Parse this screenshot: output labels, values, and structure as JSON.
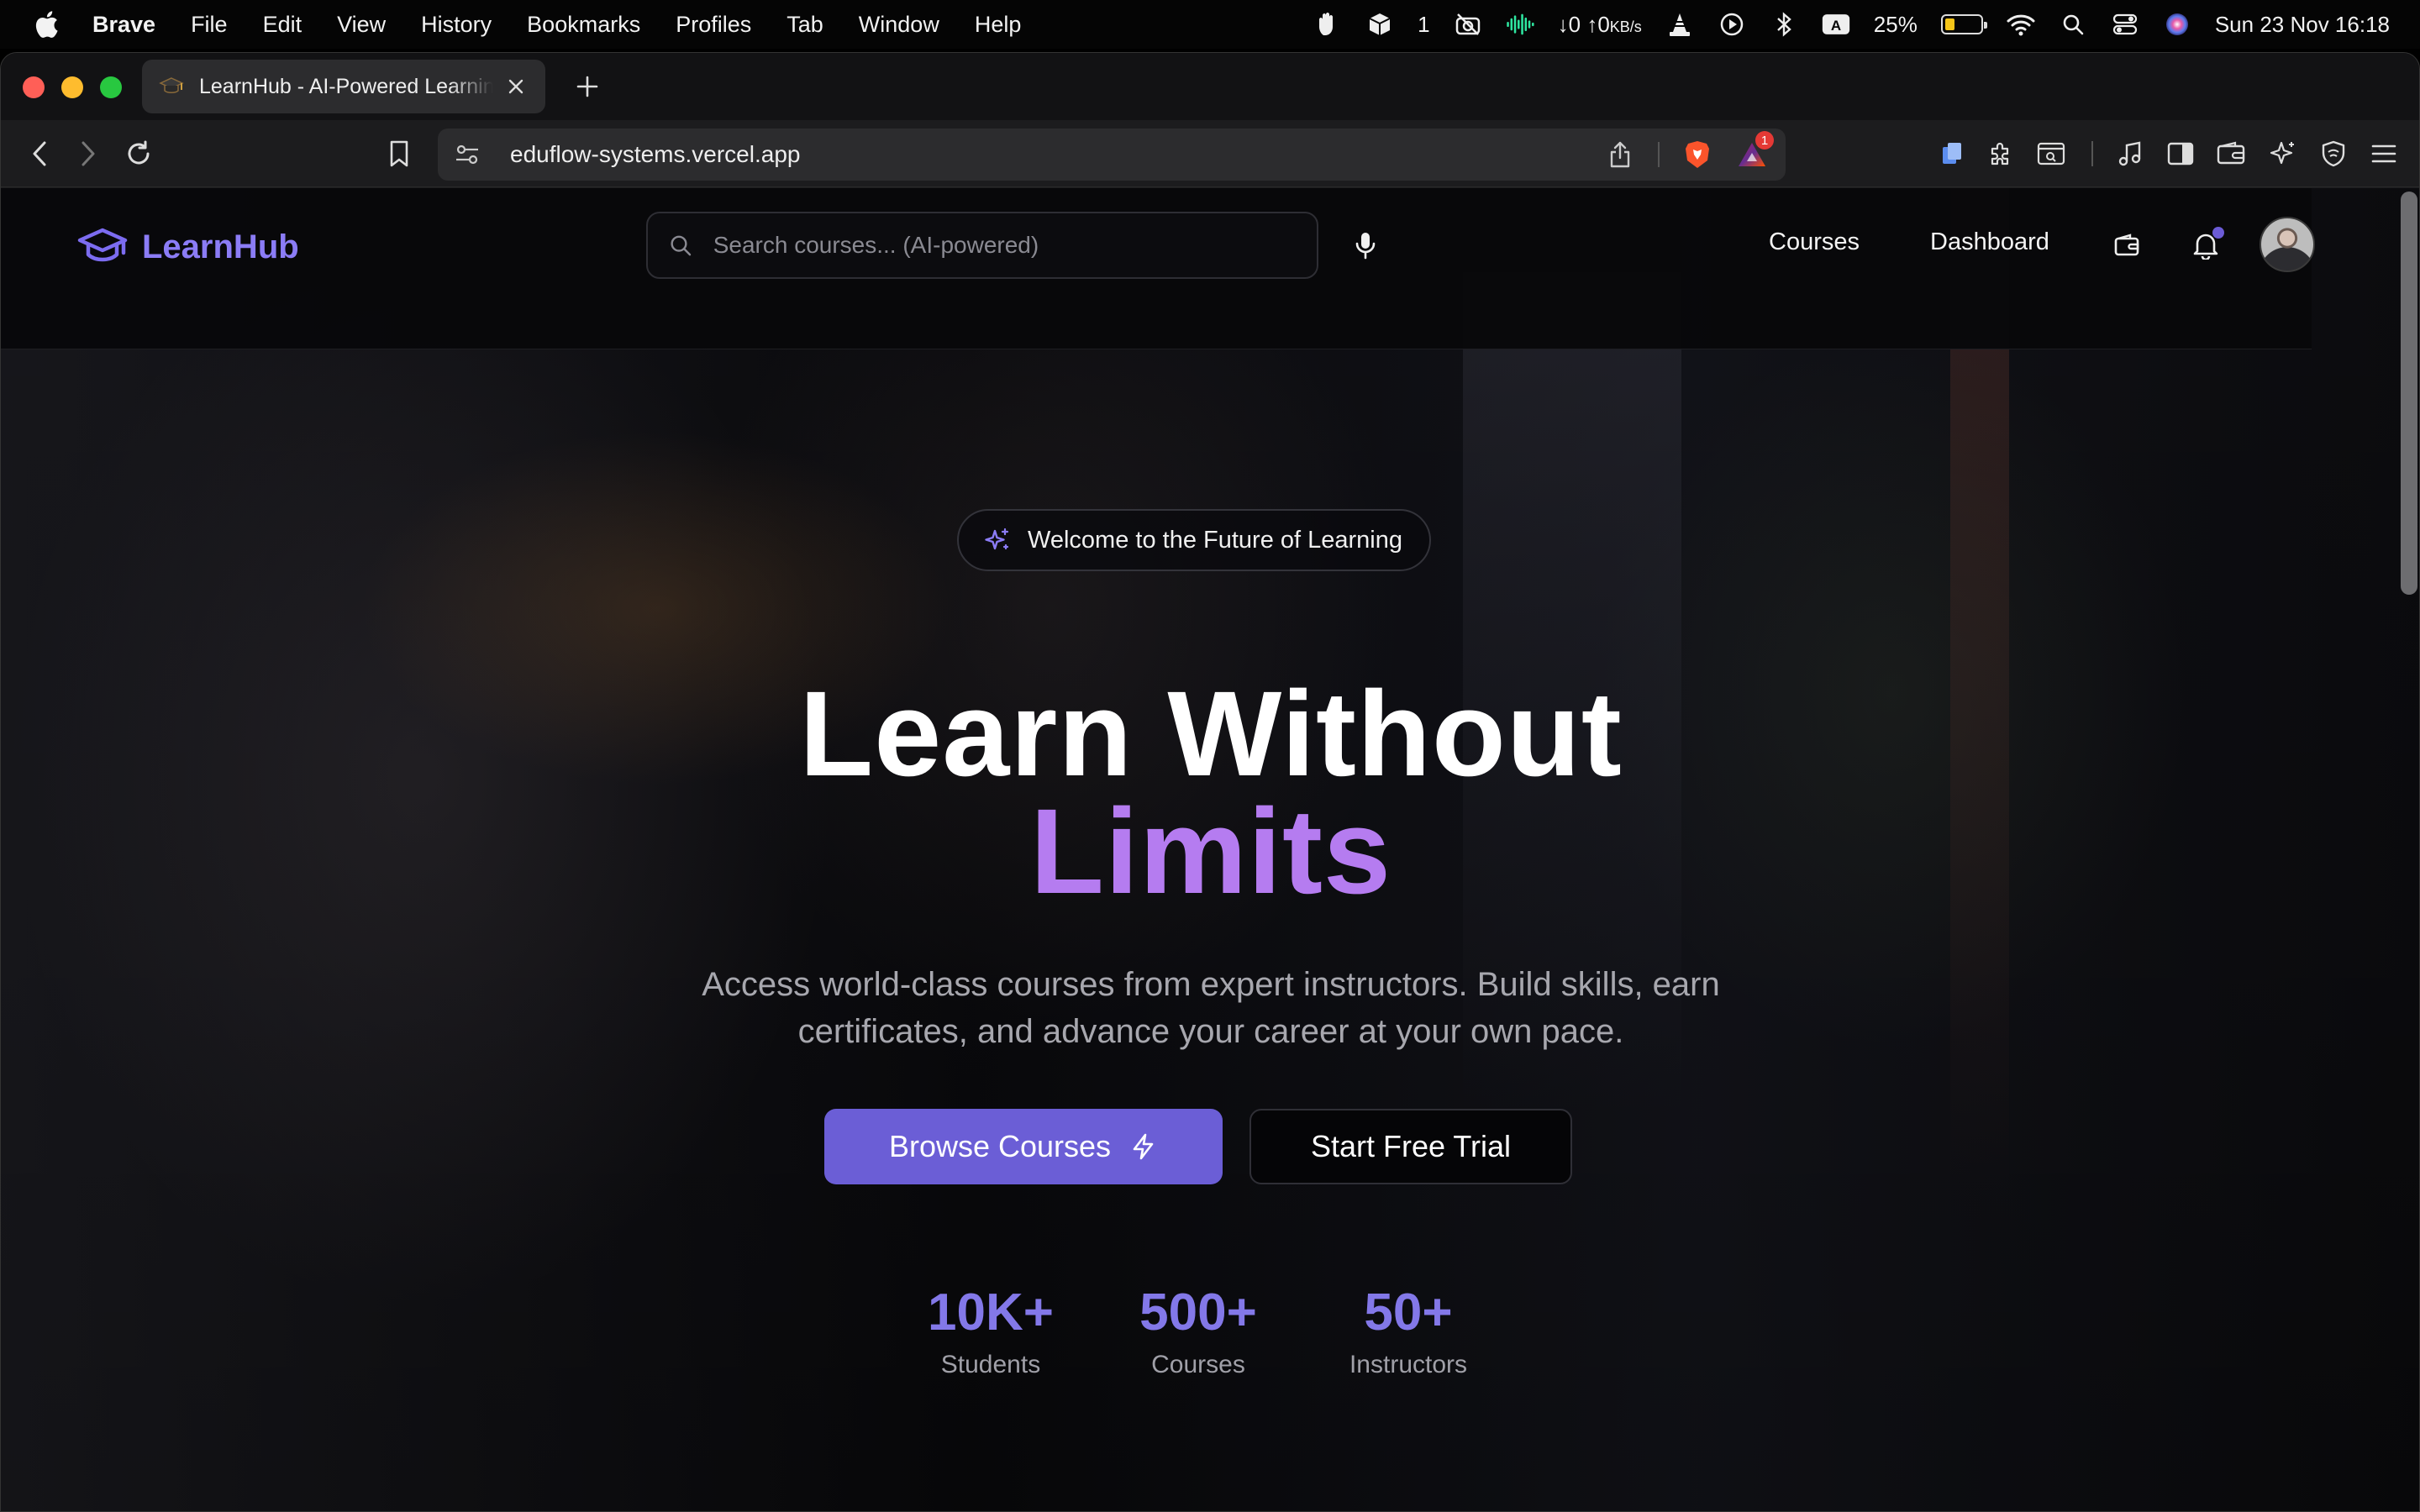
{
  "menubar": {
    "app_name": "Brave",
    "items": [
      "File",
      "Edit",
      "View",
      "History",
      "Bookmarks",
      "Profiles",
      "Tab",
      "Window",
      "Help"
    ],
    "status": {
      "tray_count": "1",
      "network_down": "↓0",
      "network_up": "↑0",
      "network_unit": "KB/s",
      "input_source": "A",
      "battery_percent": "25%",
      "battery_level": 0.25,
      "datetime": "Sun 23 Nov  16:18"
    }
  },
  "browser": {
    "tab_title": "LearnHub - AI-Powered Learning",
    "url": "eduflow-systems.vercel.app",
    "shields_notifications": "1"
  },
  "site": {
    "brand": "LearnHub",
    "search_placeholder": "Search courses... (AI-powered)",
    "nav": {
      "courses": "Courses",
      "dashboard": "Dashboard"
    },
    "hero": {
      "badge": "Welcome to the Future of Learning",
      "title_line1": "Learn Without",
      "title_line2": "Limits",
      "subtitle": "Access world-class courses from expert instructors. Build skills, earn certificates, and advance your career at your own pace.",
      "primary_cta": "Browse Courses",
      "secondary_cta": "Start Free Trial"
    },
    "stats": [
      {
        "value": "10K+",
        "label": "Students"
      },
      {
        "value": "500+",
        "label": "Courses"
      },
      {
        "value": "50+",
        "label": "Instructors"
      }
    ],
    "colors": {
      "accent": "#6b5ed6",
      "accent_text": "#b57cf0",
      "stat_number": "#8378e8"
    }
  }
}
